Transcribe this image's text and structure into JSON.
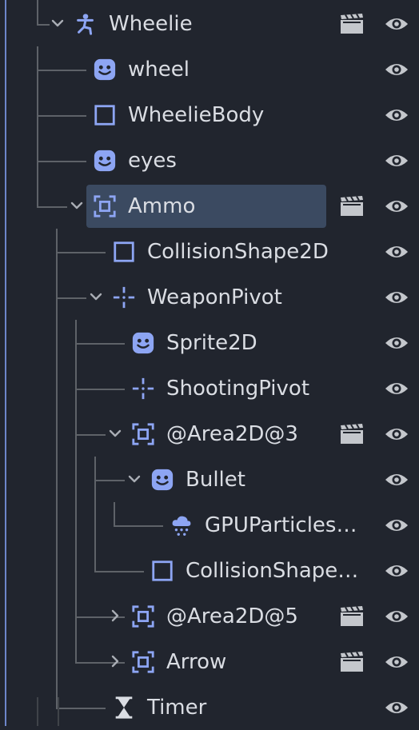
{
  "colors": {
    "background": "#21252e",
    "selection": "#3b4a61",
    "node_icon": "#8da5f3",
    "tree_line": "#5e6268",
    "label": "#dadde3",
    "accent_edge": "#6d86c9"
  },
  "nodes": [
    {
      "label": "Wheelie",
      "icon": "character-body-icon",
      "toggle": "expanded",
      "scene": true
    },
    {
      "label": "wheel",
      "icon": "sprite-icon",
      "toggle": "none",
      "scene": false
    },
    {
      "label": "WheelieBody",
      "icon": "collision-shape-icon",
      "toggle": "none",
      "scene": false
    },
    {
      "label": "eyes",
      "icon": "sprite-icon",
      "toggle": "none",
      "scene": false
    },
    {
      "label": "Ammo",
      "icon": "area-icon",
      "toggle": "expanded",
      "scene": true,
      "selected": true
    },
    {
      "label": "CollisionShape2D",
      "icon": "collision-shape-icon",
      "toggle": "none",
      "scene": false
    },
    {
      "label": "WeaponPivot",
      "icon": "marker-icon",
      "toggle": "expanded",
      "scene": false
    },
    {
      "label": "Sprite2D",
      "icon": "sprite-icon",
      "toggle": "none",
      "scene": false
    },
    {
      "label": "ShootingPivot",
      "icon": "marker-icon",
      "toggle": "none",
      "scene": false
    },
    {
      "label": "@Area2D@3",
      "icon": "area-icon",
      "toggle": "expanded",
      "scene": true
    },
    {
      "label": "Bullet",
      "icon": "sprite-icon",
      "toggle": "expanded",
      "scene": false
    },
    {
      "label": "GPUParticles…",
      "icon": "particles-icon",
      "toggle": "none",
      "scene": false
    },
    {
      "label": "CollisionShape…",
      "icon": "collision-shape-icon",
      "toggle": "none",
      "scene": false
    },
    {
      "label": "@Area2D@5",
      "icon": "area-icon",
      "toggle": "collapsed",
      "scene": true
    },
    {
      "label": "Arrow",
      "icon": "area-icon",
      "toggle": "collapsed",
      "scene": true
    },
    {
      "label": "Timer",
      "icon": "timer-icon",
      "toggle": "none",
      "scene": false
    }
  ]
}
